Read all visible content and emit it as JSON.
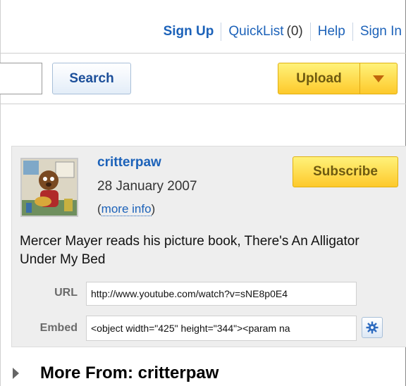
{
  "header": {
    "signup": "Sign Up",
    "quicklist": "QuickList",
    "quicklist_count": "(0)",
    "help": "Help",
    "signin": "Sign In"
  },
  "toolbar": {
    "search_value": "",
    "search_button": "Search",
    "upload_button": "Upload"
  },
  "channel": {
    "username": "critterpaw",
    "date": "28 January 2007",
    "more_info_open": "(",
    "more_info": "more info",
    "more_info_close": ")",
    "subscribe": "Subscribe",
    "description": "Mercer Mayer reads his picture book, There's An Alligator Under My Bed",
    "url_label": "URL",
    "url_value": "http://www.youtube.com/watch?v=sNE8p0E4",
    "embed_label": "Embed",
    "embed_value": "<object width=\"425\" height=\"344\"><param na"
  },
  "more_from": {
    "label": "More From: critterpaw"
  },
  "colors": {
    "link": "#1c62b9",
    "upload_bg": "#fdc92b",
    "box_bg": "#eeeeee"
  },
  "icons": {
    "upload_dropdown": "chevron-down-icon",
    "embed_options": "gear-icon",
    "more_from_toggle": "triangle-right-icon"
  }
}
